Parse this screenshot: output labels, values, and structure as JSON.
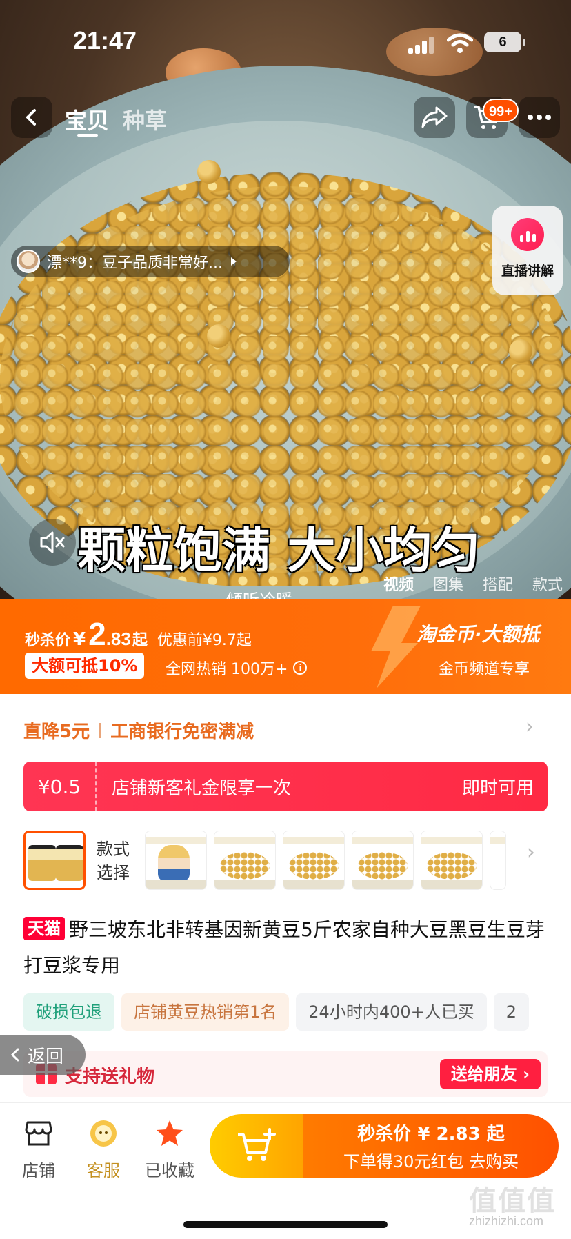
{
  "status_bar": {
    "time": "21:47",
    "battery": "6"
  },
  "nav": {
    "tabs": [
      "宝贝",
      "种草"
    ],
    "active_tab": "宝贝",
    "cart_badge": "99+"
  },
  "review": {
    "text": "漂**9：豆子品质非常好..."
  },
  "live": {
    "label": "直播讲解"
  },
  "media": {
    "headline": "颗粒饱满 大小均匀",
    "tabs": [
      "视频",
      "图集",
      "搭配",
      "款式"
    ],
    "author": "倾听冷暖_"
  },
  "price": {
    "label": "秒杀价",
    "currency": "¥",
    "int": "2",
    "dec": ".83",
    "suffix": "起",
    "original": "优惠前¥9.7起",
    "deduct_badge": "大额可抵10%",
    "hot_sales": "全网热销 100万+",
    "coin_title": "淘金币·大额抵",
    "coin_sub": "金币频道专享"
  },
  "promo": {
    "item1": "直降5元",
    "item2": "工商银行免密满减"
  },
  "coupon": {
    "amount": "¥0.5",
    "desc": "店铺新客礼金限享一次",
    "action": "即时可用"
  },
  "sku": {
    "choose_label": "款式选择"
  },
  "product": {
    "tmall": "天猫",
    "title": "野三坡东北非转基因新黄豆5斤农家自种大豆黑豆生豆芽打豆浆专用"
  },
  "chips": [
    "破损包退",
    "店铺黄豆热销第1名",
    "24小时内400+人已买",
    "2"
  ],
  "back_float": "返回",
  "gift": {
    "text": "支持送礼物",
    "button": "送给朋友"
  },
  "bottom": {
    "shop": "店铺",
    "service": "客服",
    "favorited": "已收藏",
    "buy_line1": "秒杀价 ¥ 2.83 起",
    "buy_line2": "下单得30元红包 去购买"
  },
  "watermark": {
    "text": "值值值",
    "url": "zhizhizhi.com"
  },
  "colors": {
    "accent": "#ff5000",
    "red": "#ff2a44",
    "price_banner": "#ff6a00"
  }
}
